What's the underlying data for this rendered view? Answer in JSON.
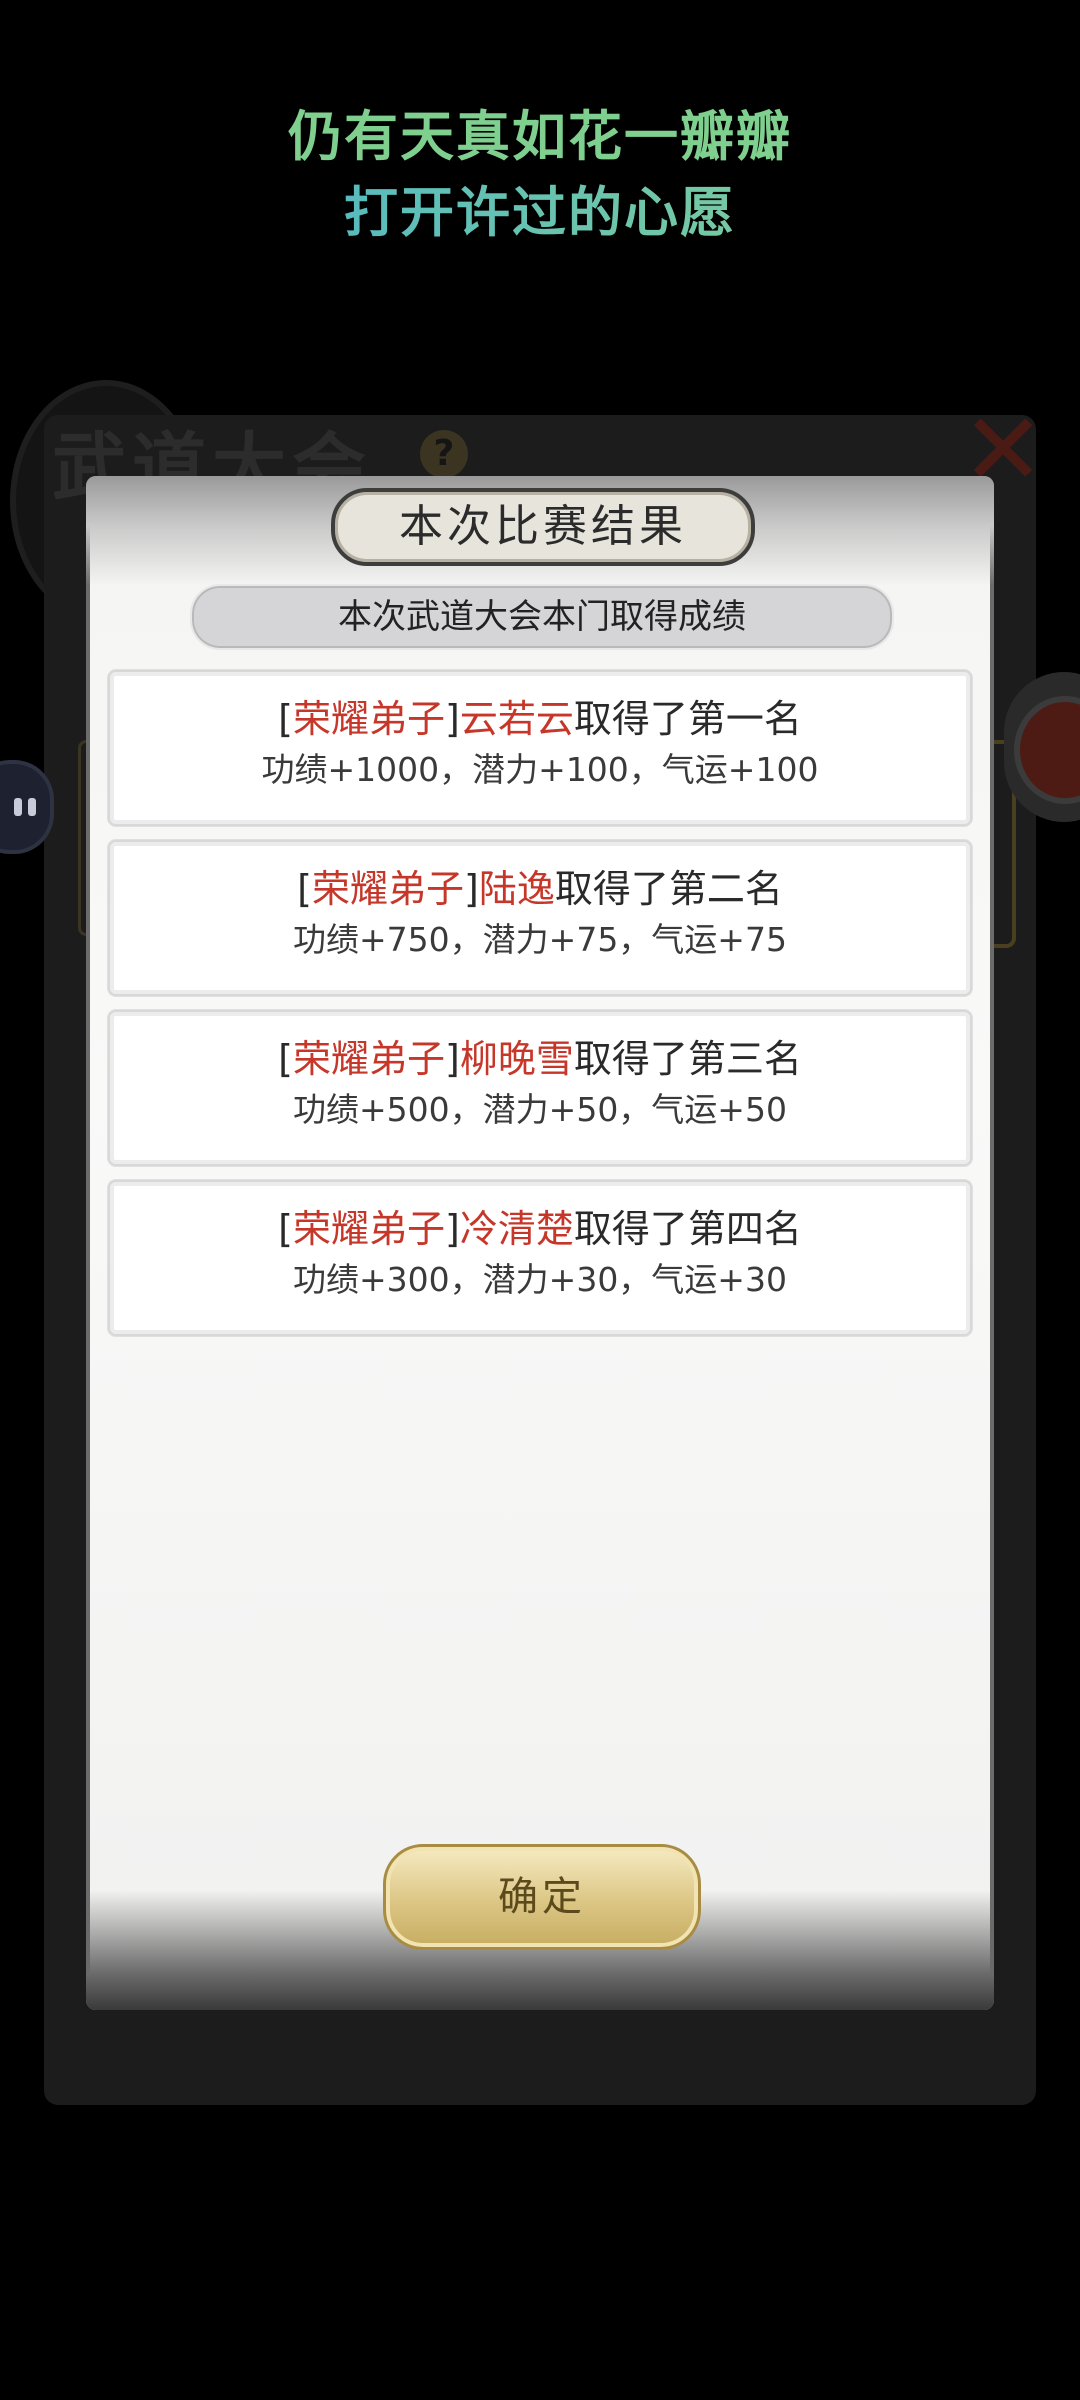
{
  "lyrics": {
    "line1": "仍有天真如花一瓣瓣",
    "line2": "打开许过的心愿"
  },
  "background": {
    "title": "武道大会",
    "help_icon": "?",
    "close_icon": "✕"
  },
  "dialog": {
    "title": "本次比赛结果",
    "subtitle": "本次武道大会本门取得成绩",
    "results": [
      {
        "open": "[",
        "tag": "荣耀弟子",
        "close": "]",
        "name": "云若云",
        "rank_text": "取得了第一名",
        "rewards": "功绩+1000，潜力+100，气运+100"
      },
      {
        "open": "[",
        "tag": "荣耀弟子",
        "close": "]",
        "name": "陆逸",
        "rank_text": "取得了第二名",
        "rewards": "功绩+750，潜力+75，气运+75"
      },
      {
        "open": "[",
        "tag": "荣耀弟子",
        "close": "]",
        "name": "柳晚雪",
        "rank_text": "取得了第三名",
        "rewards": "功绩+500，潜力+50，气运+50"
      },
      {
        "open": "[",
        "tag": "荣耀弟子",
        "close": "]",
        "name": "冷清楚",
        "rank_text": "取得了第四名",
        "rewards": "功绩+300，潜力+30，气运+30"
      }
    ],
    "confirm_label": "确定"
  },
  "colors": {
    "accent_red": "#c6372a",
    "lyric_green": "#7fcf8f",
    "lyric_blue": "#43a3d6",
    "button_gold": "#dcc684"
  }
}
